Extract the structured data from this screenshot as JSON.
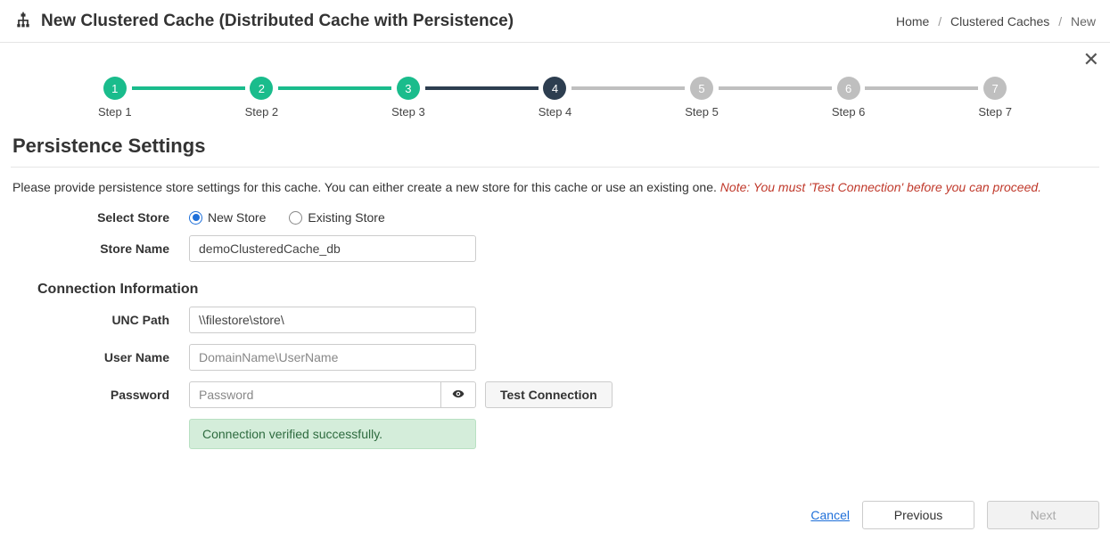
{
  "header": {
    "title": "New Clustered Cache (Distributed Cache with Persistence)",
    "breadcrumb": {
      "home": "Home",
      "caches": "Clustered Caches",
      "current": "New"
    }
  },
  "stepper": {
    "steps": [
      {
        "num": "1",
        "label": "Step 1",
        "state": "done"
      },
      {
        "num": "2",
        "label": "Step 2",
        "state": "done"
      },
      {
        "num": "3",
        "label": "Step 3",
        "state": "done"
      },
      {
        "num": "4",
        "label": "Step 4",
        "state": "current"
      },
      {
        "num": "5",
        "label": "Step 5",
        "state": "future"
      },
      {
        "num": "6",
        "label": "Step 6",
        "state": "future"
      },
      {
        "num": "7",
        "label": "Step 7",
        "state": "future"
      }
    ]
  },
  "section": {
    "title": "Persistence Settings"
  },
  "intro": {
    "text": "Please provide persistence store settings for this cache. You can either create a new store for this cache or use an existing one. ",
    "note": "Note: You must 'Test Connection' before you can proceed."
  },
  "form": {
    "selectStoreLabel": "Select Store",
    "newStore": "New Store",
    "existingStore": "Existing Store",
    "storeNameLabel": "Store Name",
    "storeNameValue": "demoClusteredCache_db",
    "connTitle": "Connection Information",
    "uncLabel": "UNC Path",
    "uncValue": "\\\\filestore\\store\\",
    "userLabel": "User Name",
    "userPlaceholder": "DomainName\\UserName",
    "passLabel": "Password",
    "passPlaceholder": "Password",
    "testBtn": "Test Connection",
    "alert": "Connection verified successfully."
  },
  "footer": {
    "cancel": "Cancel",
    "prev": "Previous",
    "next": "Next"
  }
}
